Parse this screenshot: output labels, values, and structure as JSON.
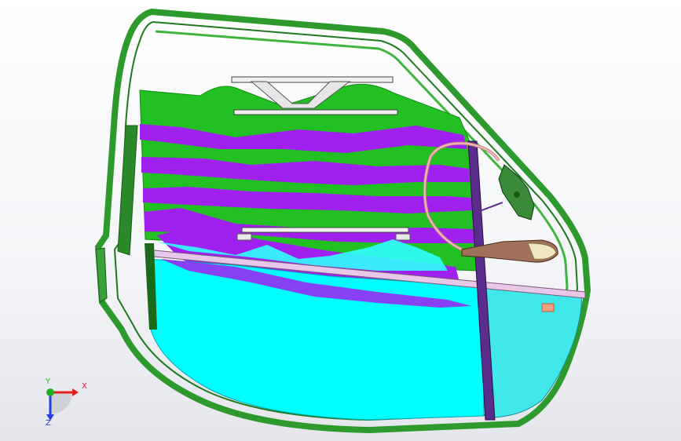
{
  "viewport": {
    "background_top": "#ffffff",
    "background_bottom": "#e4e6ec"
  },
  "model": {
    "parts": [
      "door-frame",
      "inner-trim-panel",
      "door-glass",
      "window-regulator-rail",
      "regulator-cable",
      "regulator-motor",
      "door-handle"
    ],
    "colors": {
      "frame": "#2e9a2e",
      "trim_green": "#22c022",
      "trim_purple": "#a020f0",
      "glass_cyan": "#00ffff",
      "glass_light": "#40e8ea",
      "rail": "#5a2d8c",
      "cable": "#d08a8a",
      "handle": "#a0705a"
    }
  },
  "triad": {
    "x_label": "X",
    "y_label": "Y",
    "z_label": "Z",
    "x_color": "#e02020",
    "y_color": "#20b020",
    "z_color": "#2040e0"
  }
}
